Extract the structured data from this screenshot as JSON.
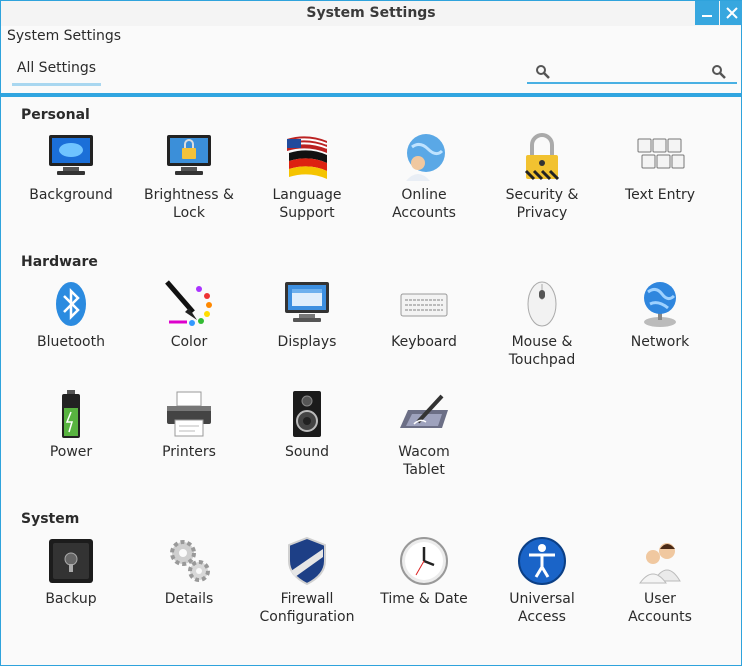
{
  "window": {
    "title": "System Settings",
    "minimize_glyph": "_",
    "close_glyph": "×"
  },
  "app_label": "System Settings",
  "tabs": [
    {
      "label": "All Settings"
    }
  ],
  "search": {
    "value": "",
    "placeholder": ""
  },
  "sections": [
    {
      "title": "Personal",
      "items": [
        {
          "label": "Background",
          "icon": "monitor-wallpaper-icon"
        },
        {
          "label": "Brightness &\nLock",
          "icon": "monitor-lock-icon"
        },
        {
          "label": "Language\nSupport",
          "icon": "flags-icon"
        },
        {
          "label": "Online\nAccounts",
          "icon": "globe-user-icon"
        },
        {
          "label": "Security &\nPrivacy",
          "icon": "padlock-icon"
        },
        {
          "label": "Text Entry",
          "icon": "keys-icon"
        }
      ]
    },
    {
      "title": "Hardware",
      "items": [
        {
          "label": "Bluetooth",
          "icon": "bluetooth-icon"
        },
        {
          "label": "Color",
          "icon": "brush-palette-icon"
        },
        {
          "label": "Displays",
          "icon": "display-icon"
        },
        {
          "label": "Keyboard",
          "icon": "keyboard-icon"
        },
        {
          "label": "Mouse &\nTouchpad",
          "icon": "mouse-icon"
        },
        {
          "label": "Network",
          "icon": "network-globe-icon"
        },
        {
          "label": "Power",
          "icon": "battery-icon"
        },
        {
          "label": "Printers",
          "icon": "printer-icon"
        },
        {
          "label": "Sound",
          "icon": "speaker-icon"
        },
        {
          "label": "Wacom\nTablet",
          "icon": "tablet-pen-icon"
        }
      ]
    },
    {
      "title": "System",
      "items": [
        {
          "label": "Backup",
          "icon": "safe-icon"
        },
        {
          "label": "Details",
          "icon": "gears-icon"
        },
        {
          "label": "Firewall\nConfiguration",
          "icon": "shield-icon"
        },
        {
          "label": "Time & Date",
          "icon": "clock-icon"
        },
        {
          "label": "Universal\nAccess",
          "icon": "accessibility-icon"
        },
        {
          "label": "User\nAccounts",
          "icon": "users-icon"
        }
      ]
    }
  ],
  "colors": {
    "accent": "#30a5e0",
    "title_button": "#37a7df"
  }
}
